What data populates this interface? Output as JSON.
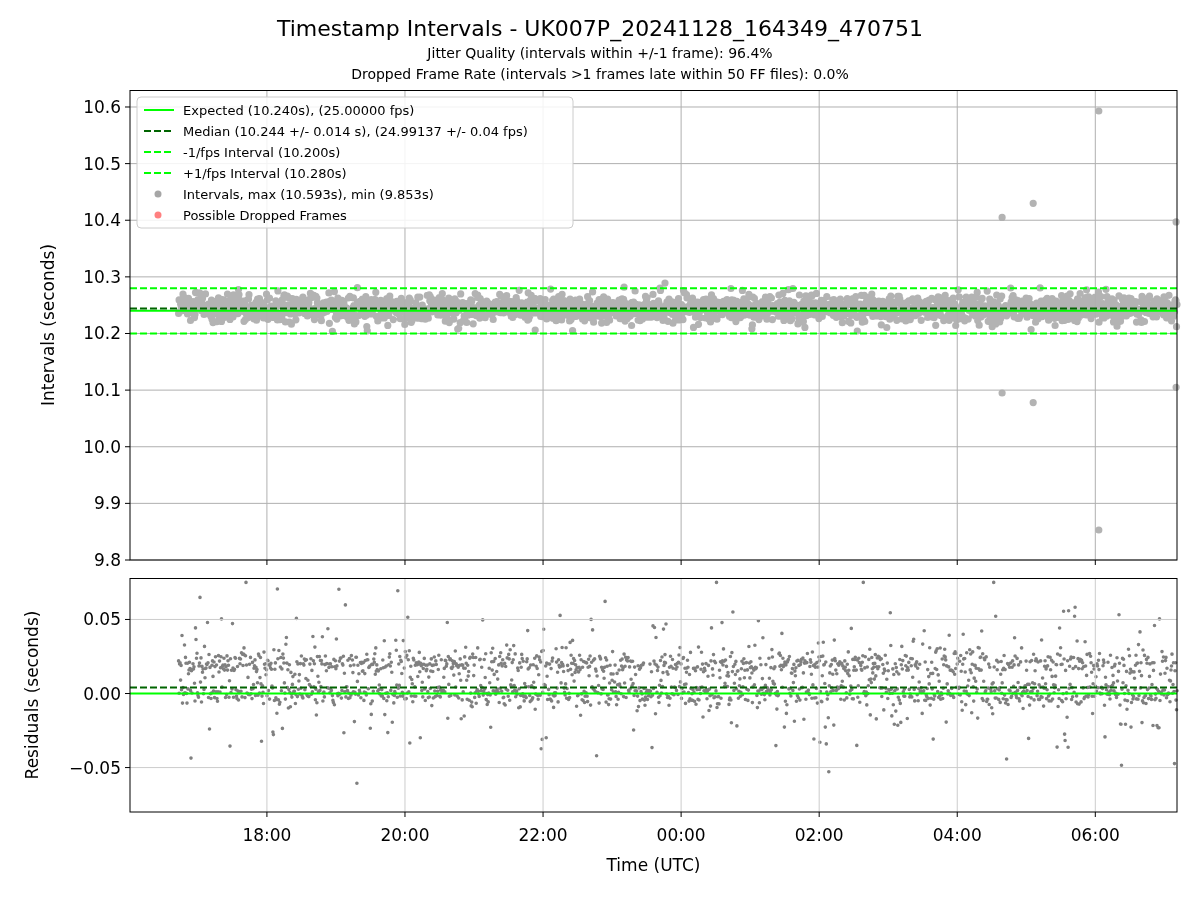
{
  "figure": {
    "title": "Timestamp Intervals - UK007P_20241128_164349_470751",
    "subtitles": [
      "Jitter Quality (intervals within +/-1 frame): 96.4%",
      "Dropped Frame Rate (intervals >1 frames late within 50 FF files): 0.0%"
    ]
  },
  "intervals_plot": {
    "legend": [
      {
        "label": "Intervals, max (10.593s), min (9.853s)",
        "color": "#a6a6a6"
      },
      {
        "label": "Possible Dropped Frames",
        "color": "#ff8080"
      }
    ],
    "chart_data": {
      "type": "line",
      "ylabel": "Intervals (seconds)",
      "grid": true,
      "legend": "upper left",
      "x": [
        "2024-11-28T16:01",
        "2024-11-29T07:11"
      ],
      "xlim": [
        "2024-11-28T16:01",
        "2024-11-29T07:11"
      ],
      "ylim": [
        9.8,
        10.63
      ],
      "yticks": [
        {
          "value": 9.8,
          "label": "9.8"
        },
        {
          "value": 9.9,
          "label": "9.9"
        },
        {
          "value": 10,
          "label": "10.0"
        },
        {
          "value": 10.1,
          "label": "10.1"
        },
        {
          "value": 10.2,
          "label": "10.2"
        },
        {
          "value": 10.3,
          "label": "10.3"
        },
        {
          "value": 10.4,
          "label": "10.4"
        },
        {
          "value": 10.5,
          "label": "10.5"
        },
        {
          "value": 10.6,
          "label": "10.6"
        }
      ],
      "series": [
        {
          "name": "Expected (10.240s), (25.00000 fps)",
          "color": "#00ff00",
          "line_style": "solid",
          "values": [
            10.24,
            10.24
          ]
        },
        {
          "name": "Median (10.244 +/- 0.014 s), (24.99137 +/- 0.04 fps)",
          "color": "#006400",
          "line_style": "dashed",
          "values": [
            10.244,
            10.244
          ]
        },
        {
          "name": "-1/fps Interval (10.200s)",
          "color": "#00ff00",
          "line_style": "dashed",
          "values": [
            10.2,
            10.2
          ]
        },
        {
          "name": "+1/fps Interval (10.280s)",
          "color": "#00ff00",
          "line_style": "dashed",
          "values": [
            10.28,
            10.28
          ]
        }
      ]
    }
  },
  "residuals_plot": {
    "chart_data": {
      "type": "line",
      "xlabel": "Time (UTC)",
      "ylabel": "Residuals (seconds)",
      "grid": true,
      "x": [
        "2024-11-28T16:01",
        "2024-11-29T07:11"
      ],
      "xlim": [
        "2024-11-28T16:01",
        "2024-11-29T07:11"
      ],
      "ylim": [
        -0.08,
        0.078
      ],
      "xticks": [
        {
          "value": "2024-11-28T18:00",
          "label": "18:00"
        },
        {
          "value": "2024-11-28T20:00",
          "label": "20:00"
        },
        {
          "value": "2024-11-28T22:00",
          "label": "22:00"
        },
        {
          "value": "2024-11-29T00:00",
          "label": "00:00"
        },
        {
          "value": "2024-11-29T02:00",
          "label": "02:00"
        },
        {
          "value": "2024-11-29T04:00",
          "label": "04:00"
        },
        {
          "value": "2024-11-29T06:00",
          "label": "06:00"
        }
      ],
      "yticks": [
        {
          "value": -0.05,
          "label": "−0.05"
        },
        {
          "value": 0,
          "label": "0.00"
        },
        {
          "value": 0.05,
          "label": "0.05"
        }
      ],
      "series": [
        {
          "color": "#00ff00",
          "line_style": "solid",
          "values": [
            0,
            0
          ]
        },
        {
          "color": "#006400",
          "line_style": "dashed",
          "values": [
            0.004,
            0.004
          ]
        }
      ]
    }
  }
}
